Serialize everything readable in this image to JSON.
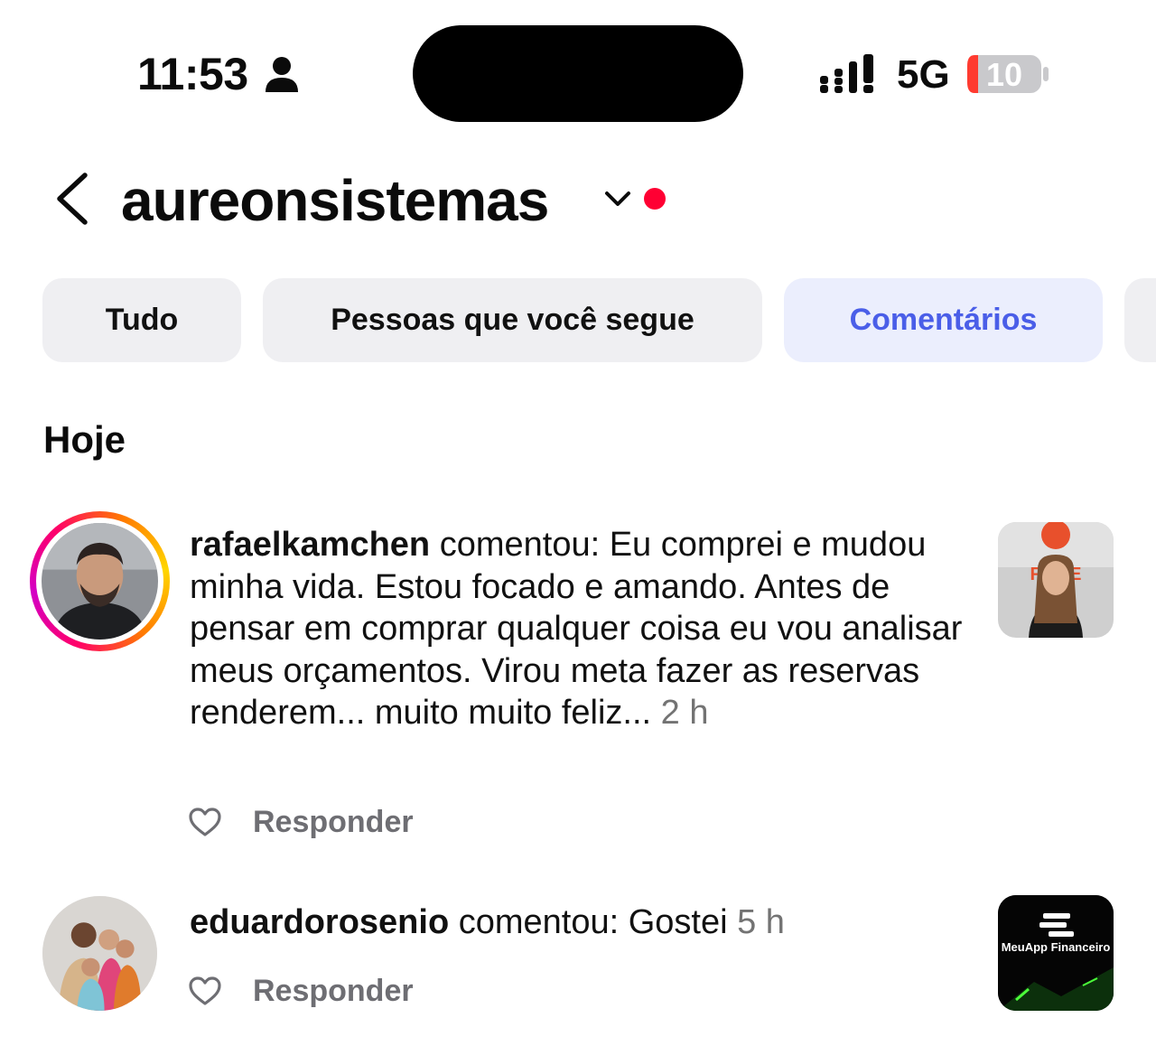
{
  "status_bar": {
    "time": "11:53",
    "network": "5G",
    "battery_level": "10",
    "icons": [
      "person-icon",
      "signal-icon",
      "battery-icon"
    ]
  },
  "header": {
    "username": "aureonsistemas",
    "icons": [
      "back-arrow-icon",
      "chevron-down-icon"
    ],
    "notification_dot_color": "#ff0033"
  },
  "filters": {
    "items": [
      {
        "label": "Tudo"
      },
      {
        "label": "Pessoas que você segue"
      },
      {
        "label": "Comentários"
      }
    ],
    "selected": "Comentários",
    "accent_color": "#4a5ee8"
  },
  "section": {
    "title": "Hoje"
  },
  "comments": [
    {
      "username": "rafaelkamchen",
      "text": " comentou: Eu comprei e mudou minha vida. Estou focado e amando. Antes de pensar em comprar qualquer coisa eu vou analisar meus orçamentos. Virou meta fazer as reservas renderem... muito muito feliz...",
      "time": " 2 h",
      "reply_label": "Responder",
      "has_story": true,
      "thumbnail_brand": "FA  PE"
    },
    {
      "username": "eduardorosenio",
      "text": " comentou: Gostei",
      "time": " 5 h",
      "reply_label": "Responder",
      "has_story": false,
      "thumbnail_brand": "MeuApp Financeiro"
    }
  ]
}
